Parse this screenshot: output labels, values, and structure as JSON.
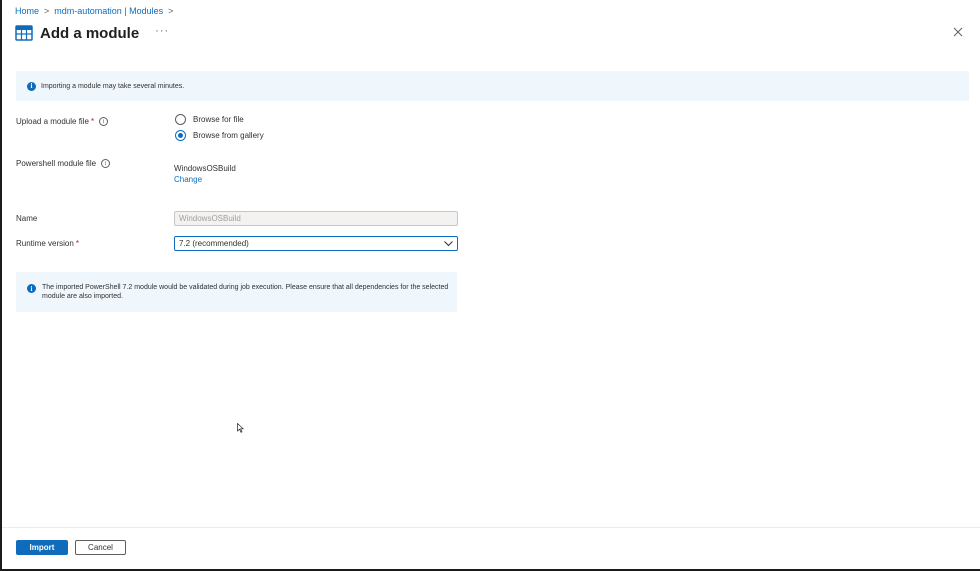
{
  "breadcrumb": {
    "items": [
      "Home",
      "mdm-automation | Modules"
    ]
  },
  "header": {
    "title": "Add a module",
    "more": "···",
    "icon": "module-grid-icon"
  },
  "banner": {
    "text": "Importing a module may take several minutes."
  },
  "form": {
    "upload_label": "Upload a module file",
    "upload_options": [
      "Browse for file",
      "Browse from gallery"
    ],
    "selected_option": "Browse from gallery",
    "ps_label": "Powershell module file",
    "ps_value": "WindowsOSBuild",
    "ps_change": "Change",
    "name_label": "Name",
    "name_value": "WindowsOSBuild",
    "runtime_label": "Runtime version",
    "runtime_value": "7.2 (recommended)",
    "required_mark": "*"
  },
  "note": {
    "text": "The imported PowerShell 7.2 module would be validated during job execution. Please ensure that all dependencies for the selected module are also imported."
  },
  "footer": {
    "import_label": "Import",
    "cancel_label": "Cancel"
  },
  "colors": {
    "accent": "#0f6cbd",
    "banner_bg": "#eff6fc",
    "required": "#a4262c"
  }
}
